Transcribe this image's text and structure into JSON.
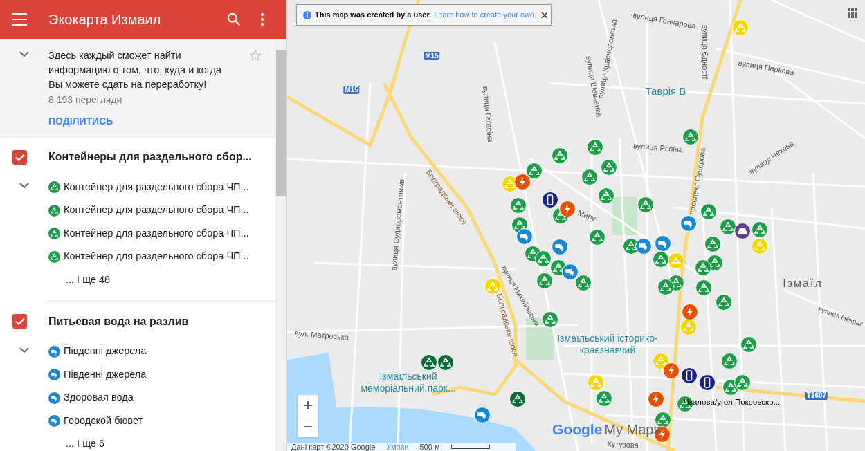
{
  "app_bar": {
    "title": "Экокарта Измаил"
  },
  "description": {
    "text": "Здесь каждый сможет найти информацию о том, что, куда и когда Вы можете сдать на переработку!",
    "views": "8 193 перегляди",
    "share": "ПОДІЛИТИСЬ",
    "starred": false
  },
  "layers": [
    {
      "title": "Контейнеры для раздельного сбор...",
      "checked": true,
      "items": [
        {
          "kind": "recycle",
          "label": "Контейнер для раздельного сбора ЧП..."
        },
        {
          "kind": "recycle",
          "label": "Контейнер для раздельного сбора ЧП..."
        },
        {
          "kind": "recycle",
          "label": "Контейнер для раздельного сбора ЧП..."
        },
        {
          "kind": "recycle",
          "label": "Контейнер для раздельного сбора ЧП..."
        }
      ],
      "more": "... І ще 48"
    },
    {
      "title": "Питьевая вода на разлив",
      "checked": true,
      "items": [
        {
          "kind": "tap",
          "label": "Південні джерела"
        },
        {
          "kind": "tap",
          "label": "Південні джерела"
        },
        {
          "kind": "tap",
          "label": "Здоровая вода"
        },
        {
          "kind": "tap",
          "label": "Городской бювет"
        }
      ],
      "more": "... І ще 6"
    }
  ],
  "notice": {
    "text": "This map was created by a user.",
    "link": "Learn how to create your own."
  },
  "map_labels": [
    "M15",
    "M15",
    "вулиця Гончарова",
    "вулиця Єдності",
    "вулиця Паркова",
    "вулиця Краснодонська",
    "вулиця Шевченка",
    "вулиця Гагаріна",
    "Таврія В",
    "вулиця Рєпіна",
    "вулиця Чехова",
    "проспект Суворова",
    "Болградське шосе",
    "Болградське шосе",
    "вулиця Судноремонтників",
    "вулиця Михайлівська",
    "Ізмаїл",
    "вулиця Некрас",
    "вул. Матроська",
    "Ізмаїльський історико-краєзнавчий",
    "Ізмаїльський меморіальний парк...",
    "T1607",
    "Кутузова",
    "Миру"
  ],
  "marker_label": "Чкалова/угол Покровско...",
  "footer": {
    "attribution": "Дані карт ©2020 Google",
    "terms": "Умови",
    "scale": "500 м"
  },
  "logo": {
    "google": "Google",
    "product": "My Maps"
  }
}
